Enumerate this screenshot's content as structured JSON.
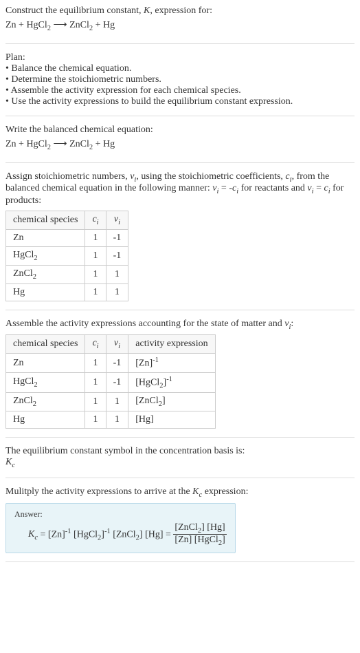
{
  "intro": {
    "line1": "Construct the equilibrium constant, K, expression for:",
    "equation": "Zn + HgCl₂ ⟶ ZnCl₂ + Hg"
  },
  "plan": {
    "header": "Plan:",
    "b1": "• Balance the chemical equation.",
    "b2": "• Determine the stoichiometric numbers.",
    "b3": "• Assemble the activity expression for each chemical species.",
    "b4": "• Use the activity expressions to build the equilibrium constant expression."
  },
  "balanced": {
    "header": "Write the balanced chemical equation:",
    "equation": "Zn + HgCl₂ ⟶ ZnCl₂ + Hg"
  },
  "stoich": {
    "intro1": "Assign stoichiometric numbers, νᵢ, using the stoichiometric coefficients, cᵢ, from the balanced chemical equation in the following manner: νᵢ = -cᵢ for reactants and νᵢ = cᵢ for products:",
    "col1": "chemical species",
    "col2": "cᵢ",
    "col3": "νᵢ",
    "rows": [
      {
        "sp": "Zn",
        "c": "1",
        "v": "-1"
      },
      {
        "sp": "HgCl₂",
        "c": "1",
        "v": "-1"
      },
      {
        "sp": "ZnCl₂",
        "c": "1",
        "v": "1"
      },
      {
        "sp": "Hg",
        "c": "1",
        "v": "1"
      }
    ]
  },
  "activity": {
    "intro": "Assemble the activity expressions accounting for the state of matter and νᵢ:",
    "col1": "chemical species",
    "col2": "cᵢ",
    "col3": "νᵢ",
    "col4": "activity expression",
    "rows": [
      {
        "sp": "Zn",
        "c": "1",
        "v": "-1",
        "ae": "[Zn]⁻¹"
      },
      {
        "sp": "HgCl₂",
        "c": "1",
        "v": "-1",
        "ae": "[HgCl₂]⁻¹"
      },
      {
        "sp": "ZnCl₂",
        "c": "1",
        "v": "1",
        "ae": "[ZnCl₂]"
      },
      {
        "sp": "Hg",
        "c": "1",
        "v": "1",
        "ae": "[Hg]"
      }
    ]
  },
  "symbol": {
    "line": "The equilibrium constant symbol in the concentration basis is:",
    "k": "K꜀"
  },
  "final": {
    "line": "Mulitply the activity expressions to arrive at the K꜀ expression:",
    "answer_label": "Answer:",
    "lhs": "K꜀ = [Zn]⁻¹ [HgCl₂]⁻¹ [ZnCl₂] [Hg] = ",
    "num": "[ZnCl₂] [Hg]",
    "den": "[Zn] [HgCl₂]"
  }
}
